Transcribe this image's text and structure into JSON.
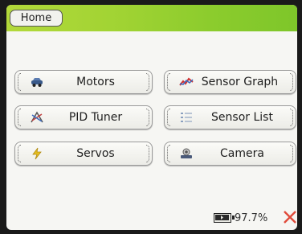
{
  "header": {
    "home_label": "Home"
  },
  "menu": {
    "motors": "Motors",
    "sensor_graph": "Sensor Graph",
    "pid_tuner": "PID Tuner",
    "sensor_list": "Sensor List",
    "servos": "Servos",
    "camera": "Camera"
  },
  "status": {
    "battery": "97.7%"
  },
  "icons": {
    "motors": "car-icon",
    "sensor_graph": "line-graph-icon",
    "pid_tuner": "tuner-icon",
    "sensor_list": "list-icon",
    "servos": "lightning-icon",
    "camera": "camera-icon",
    "battery": "battery-icon",
    "close": "close-icon"
  },
  "colors": {
    "header_green": "#9fd233",
    "close_red": "#e04a3a",
    "background": "#f6f6f3"
  }
}
